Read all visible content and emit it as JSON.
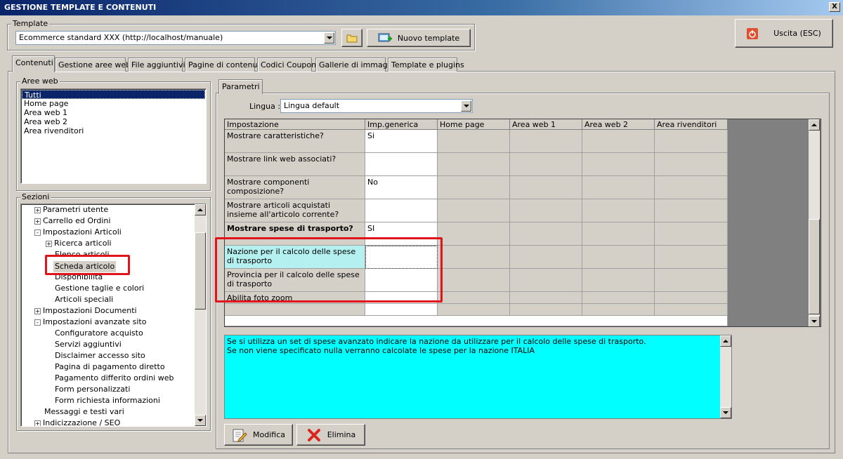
{
  "window": {
    "title": "GESTIONE TEMPLATE E CONTENUTI",
    "close": "X"
  },
  "template": {
    "group_label": "Template",
    "selected": "Ecommerce standard XXX (http://localhost/manuale)",
    "new_button": "Nuovo template"
  },
  "exit_button": "Uscita (ESC)",
  "tabs": [
    {
      "label": "Contenuti",
      "active": true
    },
    {
      "label": "Gestione aree web"
    },
    {
      "label": "File aggiuntivi"
    },
    {
      "label": "Pagine di contenuti"
    },
    {
      "label": "Codici Coupon"
    },
    {
      "label": "Gallerie di immagini"
    },
    {
      "label": "Template e plugins"
    }
  ],
  "aree_web": {
    "label": "Aree web",
    "items": [
      "Tutti",
      "Home page",
      "Area web 1",
      "Area web 2",
      "Area rivenditori"
    ],
    "selected": "Tutti"
  },
  "sezioni": {
    "label": "Sezioni",
    "items": [
      {
        "label": "Parametri utente",
        "expander": "+"
      },
      {
        "label": "Carrello ed Ordini",
        "expander": "+"
      },
      {
        "label": "Impostazioni Articoli",
        "expander": "-"
      },
      {
        "label": "Ricerca articoli",
        "expander": "+"
      },
      {
        "label": "Elenco articoli"
      },
      {
        "label": "Scheda articolo",
        "selected": true
      },
      {
        "label": "Disponibilità"
      },
      {
        "label": "Gestione taglie e colori"
      },
      {
        "label": "Articoli speciali"
      },
      {
        "label": "Impostazioni Documenti",
        "expander": "+"
      },
      {
        "label": "Impostazioni avanzate sito",
        "expander": "-"
      },
      {
        "label": "Configuratore acquisto"
      },
      {
        "label": "Servizi aggiuntivi"
      },
      {
        "label": "Disclaimer accesso sito"
      },
      {
        "label": "Pagina di pagamento diretto"
      },
      {
        "label": "Pagamento differito ordini web"
      },
      {
        "label": "Form personalizzati"
      },
      {
        "label": "Form richiesta informazioni"
      },
      {
        "label": "Messaggi e testi vari"
      },
      {
        "label": "Indicizzazione / SEO",
        "expander": "+"
      }
    ]
  },
  "parametri": {
    "tab_label": "Parametri",
    "lingua_label": "Lingua :",
    "lingua_value": "Lingua default",
    "columns": [
      "Impostazione",
      "Imp.generica",
      "Home page",
      "Area web 1",
      "Area web 2",
      "Area rivenditori"
    ],
    "rows": [
      {
        "setting": "Mostrare caratteristiche?",
        "value": "Si"
      },
      {
        "setting": "Mostrare link web associati?",
        "value": ""
      },
      {
        "setting": "Mostrare componenti composizione?",
        "value": "No"
      },
      {
        "setting": "Mostrare articoli acquistati insieme all'articolo corrente?",
        "value": ""
      },
      {
        "setting": "Mostrare spese di trasporto?",
        "value": "SI",
        "bold": true
      },
      {
        "setting": "Nazione per il calcolo delle spese di trasporto",
        "value": "",
        "selected": true
      },
      {
        "setting": "Provincia per il calcolo delle spese di trasporto",
        "value": ""
      },
      {
        "setting": "Abilita foto zoom",
        "value": ""
      },
      {
        "setting": "",
        "value": ""
      }
    ],
    "description": "Se si utilizza un set di spese avanzato indicare la nazione da utilizzare per il calcolo delle spese di trasporto.\nSe non viene specificato nulla verranno calcolate le spese per la nazione ITALIA",
    "modifica_button": "Modifica",
    "elimina_button": "Elimina"
  },
  "colors": {
    "selected_row": "#b4f0f0",
    "description_bg": "#00ffff",
    "highlight_box": "#e0141a"
  }
}
